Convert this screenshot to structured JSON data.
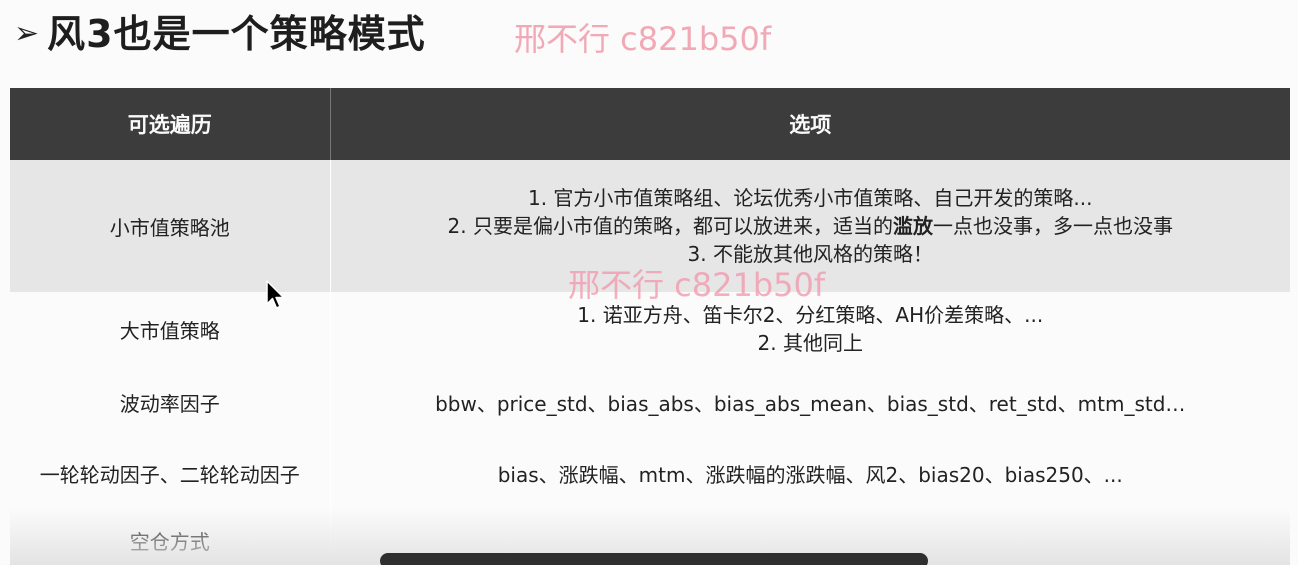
{
  "slide": {
    "title_arrow": "➢",
    "title": "风3也是一个策略模式",
    "watermark_top": "邢不行 c821b50f",
    "watermark_middle": "邢不行 c821b50f"
  },
  "table": {
    "headers": [
      "可选遍历",
      "选项"
    ],
    "rows": [
      {
        "name": "小市值策略池",
        "lines": [
          "1. 官方小市值策略组、论坛优秀小市值策略、自己开发的策略...",
          "3. 不能放其他风格的策略！"
        ],
        "line2_pre": "2. 只要是偏小市值的策略，都可以放进来，适当的",
        "line2_bold": "滥放",
        "line2_post": "一点也没事，多一点也没事"
      },
      {
        "name": "大市值策略",
        "lines": [
          "1. 诺亚方舟、笛卡尔2、分红策略、AH价差策略、...",
          "2. 其他同上"
        ]
      },
      {
        "name": "波动率因子",
        "text": "bbw、price_std、bias_abs、bias_abs_mean、bias_std、ret_std、mtm_std…"
      },
      {
        "name": "一轮轮动因子、二轮轮动因子",
        "text": "bias、涨跌幅、mtm、涨跌幅的涨跌幅、风2、bias20、bias250、..."
      },
      {
        "name": "空仓方式",
        "text": ""
      }
    ]
  },
  "colors": {
    "header_bg": "#3c3c3c",
    "shaded_row_bg": "#e6e6e6",
    "watermark": "#f2a9b6"
  }
}
